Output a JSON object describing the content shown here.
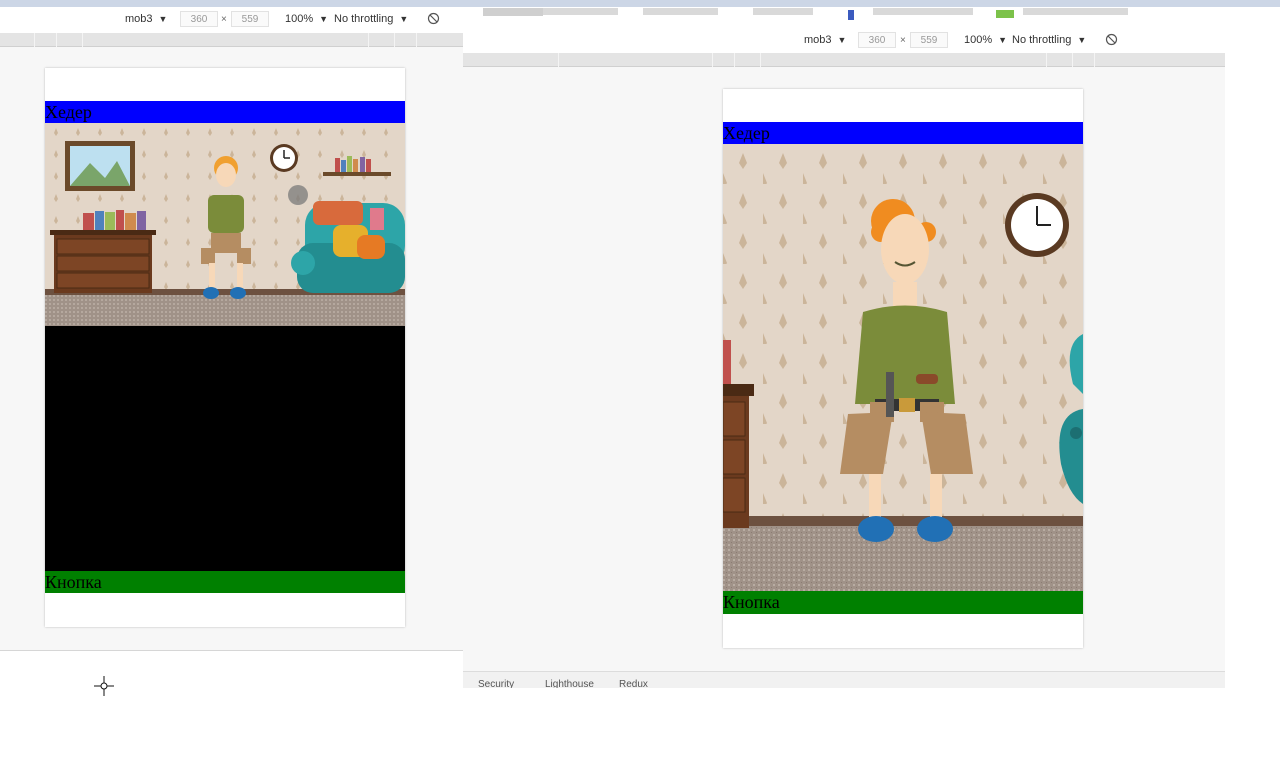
{
  "left_panel": {
    "device_name": "mob3",
    "width": "360",
    "height": "559",
    "zoom": "100%",
    "throttling": "No throttling",
    "header_label": "Хедер",
    "button_label": "Кнопка"
  },
  "right_panel": {
    "device_name": "mob3",
    "width": "360",
    "height": "559",
    "zoom": "100%",
    "throttling": "No throttling",
    "header_label": "Хедер",
    "button_label": "Кнопка",
    "bottom_tabs": [
      "Security",
      "Lighthouse",
      "Redux"
    ]
  },
  "colors": {
    "header": "#0000ff",
    "button": "#008000",
    "canvas": "#000000"
  }
}
